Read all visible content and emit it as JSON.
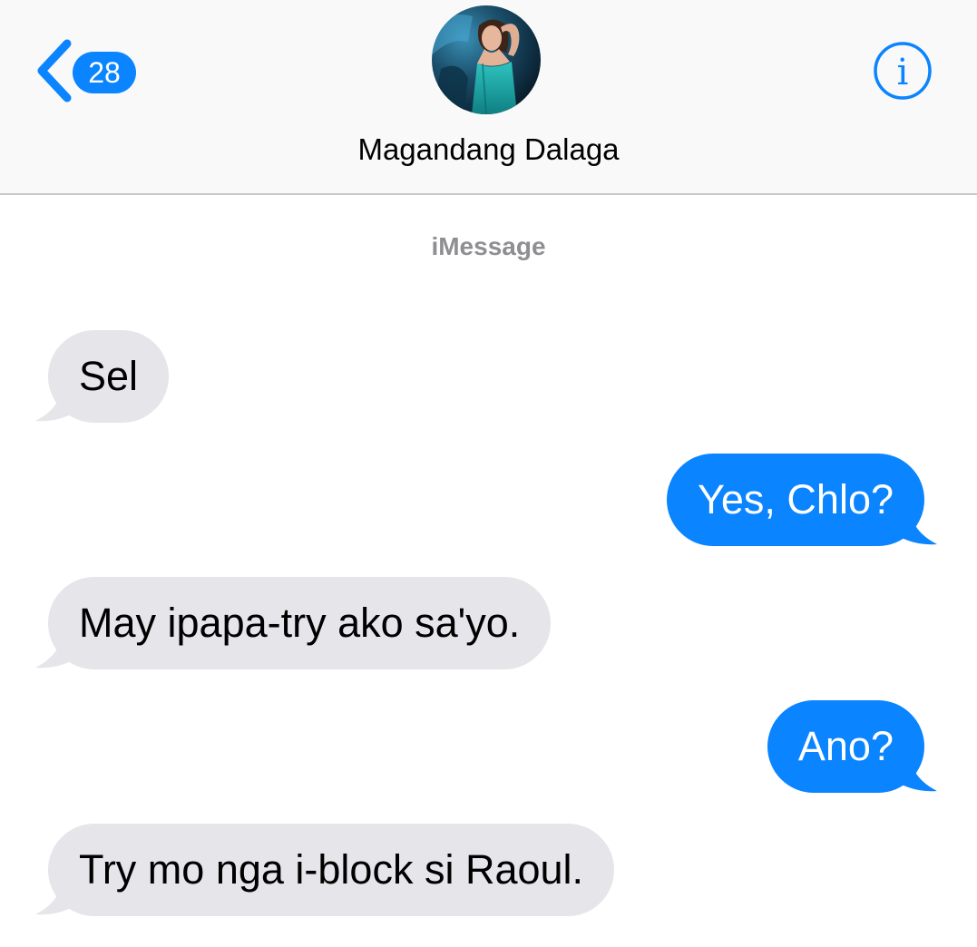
{
  "header": {
    "back_badge": "28",
    "contact_name": "Magandang Dalaga",
    "info_label": "i"
  },
  "conversation": {
    "service_label": "iMessage",
    "messages": [
      {
        "direction": "incoming",
        "text": "Sel"
      },
      {
        "direction": "outgoing",
        "text": "Yes, Chlo?"
      },
      {
        "direction": "incoming",
        "text": "May ipapa-try ako sa'yo."
      },
      {
        "direction": "outgoing",
        "text": "Ano?"
      },
      {
        "direction": "incoming",
        "text": "Try mo nga i-block si Raoul."
      }
    ]
  },
  "colors": {
    "accent": "#0a84ff",
    "incoming_bubble": "#e5e5ea",
    "header_bg": "#f9f9f9",
    "secondary_text": "#8e8e93"
  },
  "icons": {
    "back": "chevron-left-icon",
    "info": "info-circle-icon"
  }
}
